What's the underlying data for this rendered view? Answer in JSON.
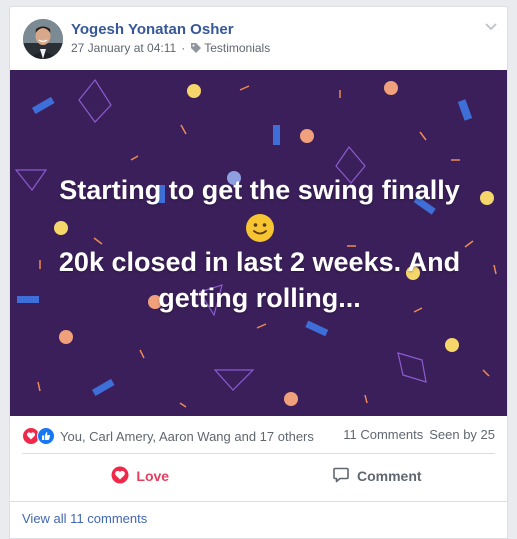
{
  "post": {
    "author_name": "Yogesh Yonatan Osher",
    "timestamp": "27 January at 04:11",
    "separator": "·",
    "group_tag": "Testimonials",
    "text_line1": "Starting to get the swing finally",
    "text_line3": "20k closed in last 2 weeks. And",
    "text_line4": "getting rolling...",
    "emoji": "slightly-smiling-face",
    "background_color": "#3b1f5a"
  },
  "reactions": {
    "summary": "You, Carl Amery, Aaron Wang and 17 others",
    "icons": [
      "love-reaction-icon",
      "like-reaction-icon"
    ],
    "love_color": "#f0284a",
    "like_color": "#1877f2"
  },
  "stats": {
    "comments": "11 Comments",
    "seen_by": "Seen by 25"
  },
  "actions": {
    "love_label": "Love",
    "comment_label": "Comment",
    "love_color": "#e4405f"
  },
  "comments": {
    "view_all_label": "View all 11 comments"
  }
}
